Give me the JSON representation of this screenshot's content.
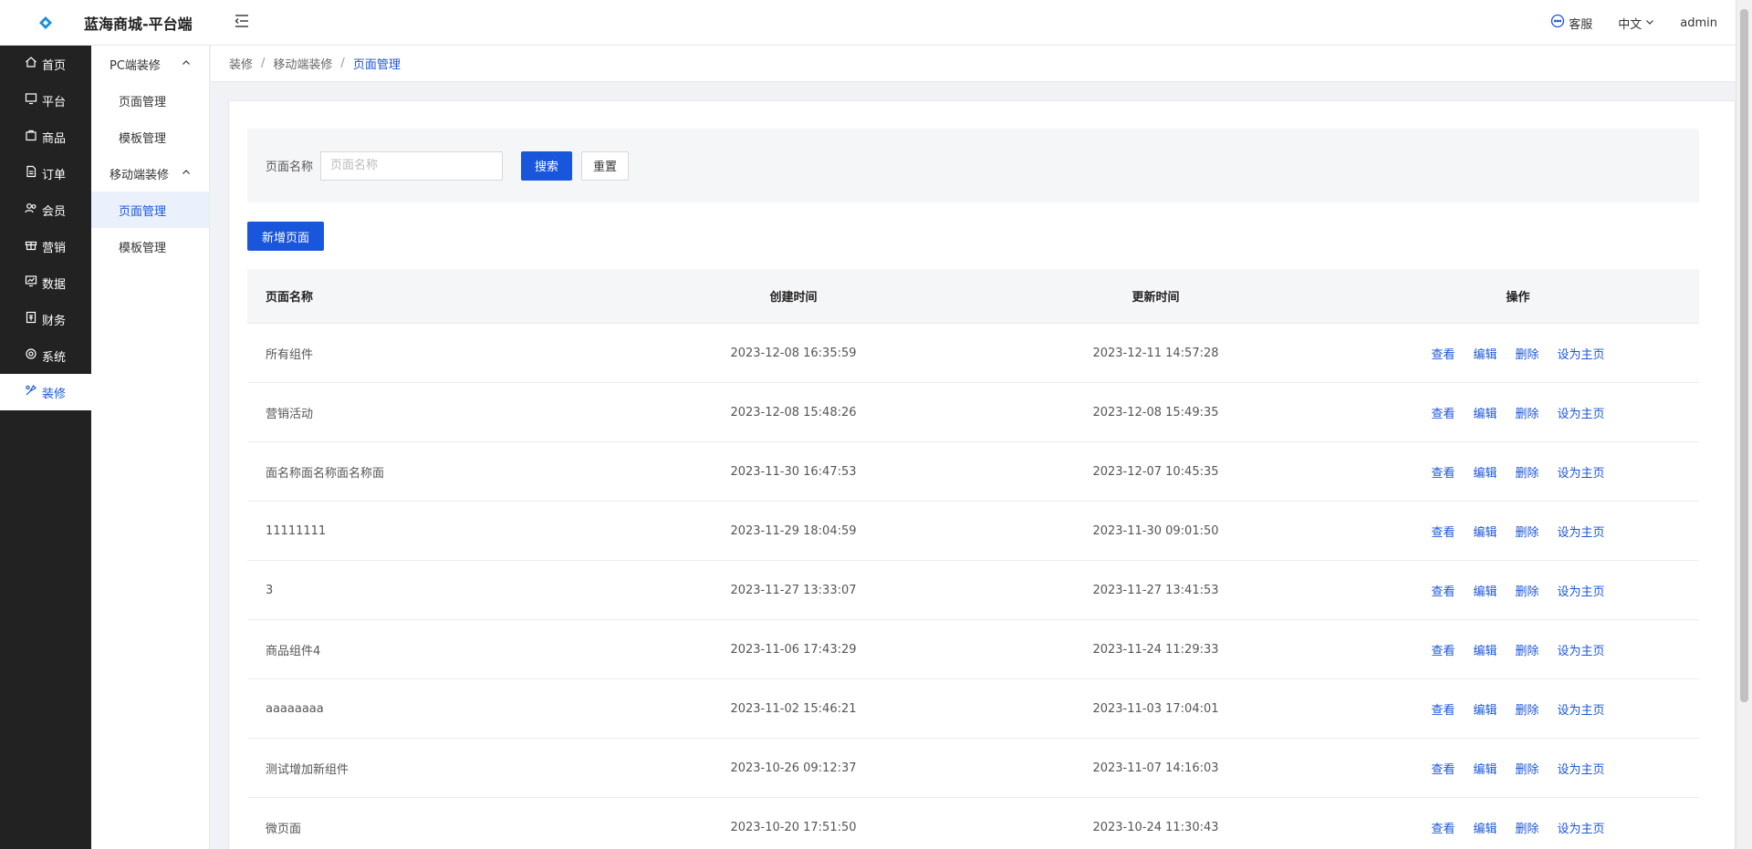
{
  "header": {
    "brand": "蓝海商城-平台端",
    "service_label": "客服",
    "lang_label": "中文",
    "user_label": "admin",
    "accent": "#1a56db"
  },
  "nav_primary": [
    {
      "label": "首页",
      "icon": "home-icon"
    },
    {
      "label": "平台",
      "icon": "monitor-icon"
    },
    {
      "label": "商品",
      "icon": "bag-icon"
    },
    {
      "label": "订单",
      "icon": "document-icon"
    },
    {
      "label": "会员",
      "icon": "users-icon"
    },
    {
      "label": "营销",
      "icon": "gift-icon"
    },
    {
      "label": "数据",
      "icon": "chart-icon"
    },
    {
      "label": "财务",
      "icon": "finance-icon"
    },
    {
      "label": "系统",
      "icon": "settings-icon"
    },
    {
      "label": "装修",
      "icon": "decorate-icon",
      "active": true
    }
  ],
  "nav_secondary": {
    "groups": [
      {
        "label": "PC端装修",
        "items": [
          "页面管理",
          "模板管理"
        ]
      },
      {
        "label": "移动端装修",
        "items": [
          "页面管理",
          "模板管理"
        ]
      }
    ],
    "active": "移动端装修/页面管理"
  },
  "breadcrumb": [
    "装修",
    "移动端装修",
    "页面管理"
  ],
  "search": {
    "label": "页面名称",
    "placeholder": "页面名称",
    "value": "",
    "search_btn": "搜索",
    "reset_btn": "重置"
  },
  "new_button": "新增页面",
  "table": {
    "columns": [
      "页面名称",
      "创建时间",
      "更新时间",
      "操作"
    ],
    "actions": [
      "查看",
      "编辑",
      "删除",
      "设为主页"
    ],
    "rows": [
      {
        "name": "所有组件",
        "created": "2023-12-08 16:35:59",
        "updated": "2023-12-11 14:57:28"
      },
      {
        "name": "营销活动",
        "created": "2023-12-08 15:48:26",
        "updated": "2023-12-08 15:49:35"
      },
      {
        "name": "面名称面名称面名称面",
        "created": "2023-11-30 16:47:53",
        "updated": "2023-12-07 10:45:35"
      },
      {
        "name": "11111111",
        "created": "2023-11-29 18:04:59",
        "updated": "2023-11-30 09:01:50"
      },
      {
        "name": "3",
        "created": "2023-11-27 13:33:07",
        "updated": "2023-11-27 13:41:53"
      },
      {
        "name": "商品组件4",
        "created": "2023-11-06 17:43:29",
        "updated": "2023-11-24 11:29:33"
      },
      {
        "name": "aaaaaaaa",
        "created": "2023-11-02 15:46:21",
        "updated": "2023-11-03 17:04:01"
      },
      {
        "name": "测试增加新组件",
        "created": "2023-10-26 09:12:37",
        "updated": "2023-11-07 14:16:03"
      },
      {
        "name": "微页面",
        "created": "2023-10-20 17:51:50",
        "updated": "2023-10-24 11:30:43"
      }
    ]
  }
}
